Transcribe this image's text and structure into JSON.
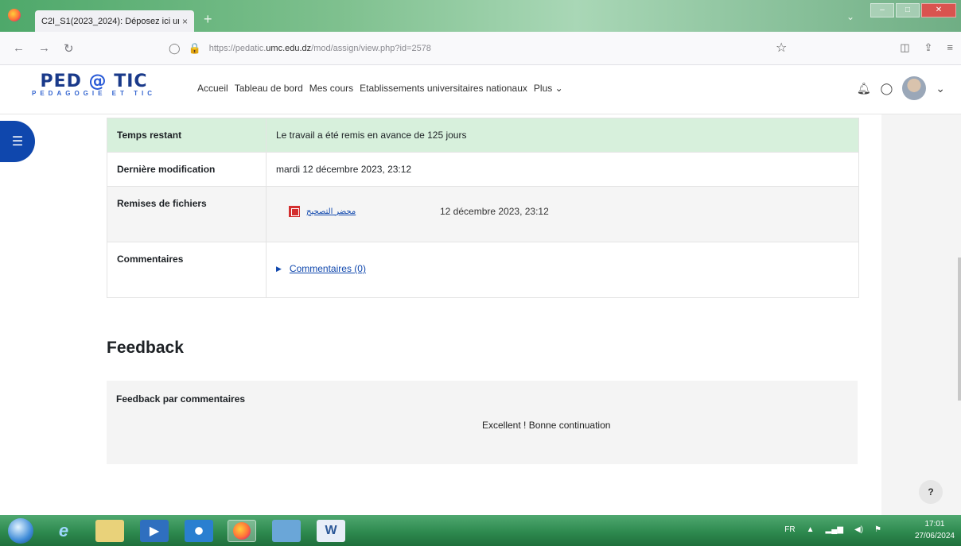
{
  "browser": {
    "tab_title": "C2I_S1(2023_2024): Déposez ici une",
    "tab_close": "×",
    "new_tab": "+",
    "url_prefix": "https://pedatic.",
    "url_domain": "umc.edu.dz",
    "url_path": "/mod/assign/view.php?id=2578"
  },
  "site": {
    "logo_main": "PED",
    "logo_at": "@",
    "logo_tail": "TIC",
    "logo_sub": "PEDAGOGIE ET TIC",
    "menu": [
      "Accueil",
      "Tableau de bord",
      "Mes cours",
      "Etablissements universitaires nationaux",
      "Plus"
    ]
  },
  "status": {
    "time_label": "Temps restant",
    "time_value": "Le travail a été remis en avance de 125 jours",
    "modified_label": "Dernière modification",
    "modified_value": "mardi 12 décembre 2023, 23:12",
    "files_label": "Remises de fichiers",
    "file_name": "محضر التصحيح",
    "file_date": "12 décembre 2023, 23:12",
    "comments_label": "Commentaires",
    "comments_link": "Commentaires (0)"
  },
  "feedback": {
    "heading": "Feedback",
    "comment_label": "Feedback par commentaires",
    "comment_value": "Excellent ! Bonne continuation"
  },
  "help_label": "?",
  "taskbar": {
    "lang": "FR",
    "time": "17:01",
    "date": "27/06/2024"
  }
}
